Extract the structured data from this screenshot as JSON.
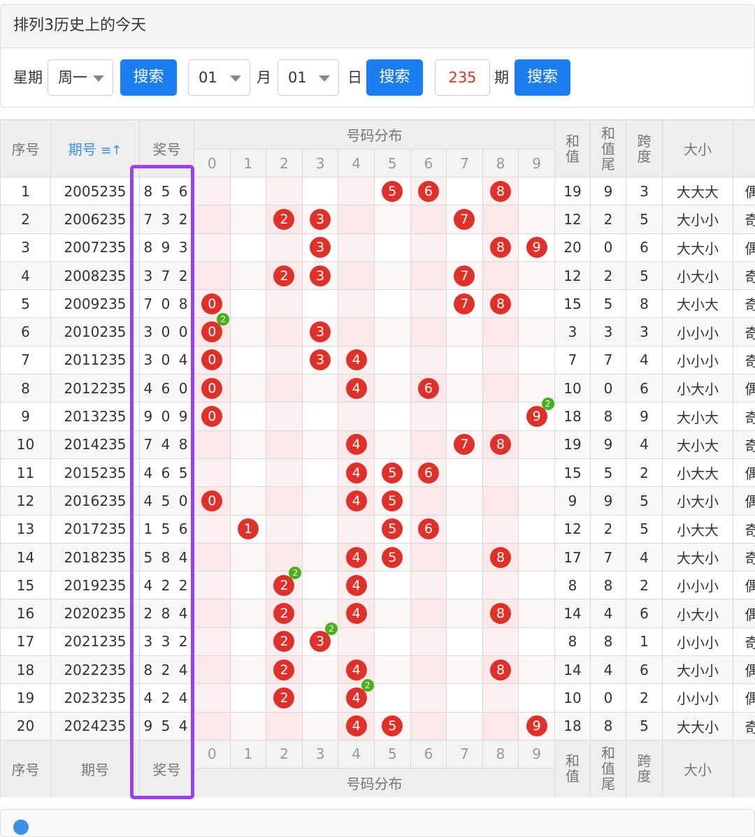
{
  "panel": {
    "title": "排列3历史上的今天",
    "weekday_label": "星期",
    "weekday_value": "周一",
    "search1": "搜索",
    "month_value": "01",
    "month_label": "月",
    "day_value": "01",
    "day_label": "日",
    "search2": "搜索",
    "issue_value": "235",
    "issue_label": "期",
    "search3": "搜索"
  },
  "table": {
    "headers": {
      "index": "序号",
      "issue": "期号",
      "sort_icon": "sort-icon",
      "prize": "奖号",
      "distribution": "号码分布",
      "sum": "和值",
      "sum_tail": "和值尾",
      "span": "跨度",
      "size": "大小"
    },
    "digits": [
      "0",
      "1",
      "2",
      "3",
      "4",
      "5",
      "6",
      "7",
      "8",
      "9"
    ],
    "rows": [
      {
        "idx": "1",
        "issue": "2005235",
        "prize": "8 5 6",
        "balls": [
          "5",
          "6",
          "8"
        ],
        "repeat": null,
        "sum": "19",
        "tail": "9",
        "span": "3",
        "size": "大大大",
        "parity": "偶"
      },
      {
        "idx": "2",
        "issue": "2006235",
        "prize": "7 3 2",
        "balls": [
          "2",
          "3",
          "7"
        ],
        "repeat": null,
        "sum": "12",
        "tail": "2",
        "span": "5",
        "size": "大小小",
        "parity": "奇"
      },
      {
        "idx": "3",
        "issue": "2007235",
        "prize": "8 9 3",
        "balls": [
          "3",
          "8",
          "9"
        ],
        "repeat": null,
        "sum": "20",
        "tail": "0",
        "span": "6",
        "size": "大大小",
        "parity": "偶"
      },
      {
        "idx": "4",
        "issue": "2008235",
        "prize": "3 7 2",
        "balls": [
          "2",
          "3",
          "7"
        ],
        "repeat": null,
        "sum": "12",
        "tail": "2",
        "span": "5",
        "size": "小大小",
        "parity": "奇"
      },
      {
        "idx": "5",
        "issue": "2009235",
        "prize": "7 0 8",
        "balls": [
          "0",
          "7",
          "8"
        ],
        "repeat": null,
        "sum": "15",
        "tail": "5",
        "span": "8",
        "size": "大小大",
        "parity": "奇"
      },
      {
        "idx": "6",
        "issue": "2010235",
        "prize": "3 0 0",
        "balls": [
          "0",
          "3"
        ],
        "repeat": {
          "digit": "0",
          "count": "2"
        },
        "sum": "3",
        "tail": "3",
        "span": "3",
        "size": "小小小",
        "parity": "奇"
      },
      {
        "idx": "7",
        "issue": "2011235",
        "prize": "3 0 4",
        "balls": [
          "0",
          "3",
          "4"
        ],
        "repeat": null,
        "sum": "7",
        "tail": "7",
        "span": "4",
        "size": "小小小",
        "parity": "奇"
      },
      {
        "idx": "8",
        "issue": "2012235",
        "prize": "4 6 0",
        "balls": [
          "0",
          "4",
          "6"
        ],
        "repeat": null,
        "sum": "10",
        "tail": "0",
        "span": "6",
        "size": "小大小",
        "parity": "偶"
      },
      {
        "idx": "9",
        "issue": "2013235",
        "prize": "9 0 9",
        "balls": [
          "0",
          "9"
        ],
        "repeat": {
          "digit": "9",
          "count": "2"
        },
        "sum": "18",
        "tail": "8",
        "span": "9",
        "size": "大小大",
        "parity": "奇"
      },
      {
        "idx": "10",
        "issue": "2014235",
        "prize": "7 4 8",
        "balls": [
          "4",
          "7",
          "8"
        ],
        "repeat": null,
        "sum": "19",
        "tail": "9",
        "span": "4",
        "size": "大小大",
        "parity": "奇"
      },
      {
        "idx": "11",
        "issue": "2015235",
        "prize": "4 6 5",
        "balls": [
          "4",
          "5",
          "6"
        ],
        "repeat": null,
        "sum": "15",
        "tail": "5",
        "span": "2",
        "size": "小大大",
        "parity": "偶"
      },
      {
        "idx": "12",
        "issue": "2016235",
        "prize": "4 5 0",
        "balls": [
          "0",
          "4",
          "5"
        ],
        "repeat": null,
        "sum": "9",
        "tail": "9",
        "span": "5",
        "size": "小大小",
        "parity": "偶"
      },
      {
        "idx": "13",
        "issue": "2017235",
        "prize": "1 5 6",
        "balls": [
          "1",
          "5",
          "6"
        ],
        "repeat": null,
        "sum": "12",
        "tail": "2",
        "span": "5",
        "size": "小大大",
        "parity": "奇"
      },
      {
        "idx": "14",
        "issue": "2018235",
        "prize": "5 8 4",
        "balls": [
          "4",
          "5",
          "8"
        ],
        "repeat": null,
        "sum": "17",
        "tail": "7",
        "span": "4",
        "size": "大大小",
        "parity": "奇"
      },
      {
        "idx": "15",
        "issue": "2019235",
        "prize": "4 2 2",
        "balls": [
          "2",
          "4"
        ],
        "repeat": {
          "digit": "2",
          "count": "2"
        },
        "sum": "8",
        "tail": "8",
        "span": "2",
        "size": "小小小",
        "parity": "偶"
      },
      {
        "idx": "16",
        "issue": "2020235",
        "prize": "2 8 4",
        "balls": [
          "2",
          "4",
          "8"
        ],
        "repeat": null,
        "sum": "14",
        "tail": "4",
        "span": "6",
        "size": "小大小",
        "parity": "偶"
      },
      {
        "idx": "17",
        "issue": "2021235",
        "prize": "3 3 2",
        "balls": [
          "2",
          "3"
        ],
        "repeat": {
          "digit": "3",
          "count": "2"
        },
        "sum": "8",
        "tail": "8",
        "span": "1",
        "size": "小小小",
        "parity": "奇"
      },
      {
        "idx": "18",
        "issue": "2022235",
        "prize": "8 2 4",
        "balls": [
          "2",
          "4",
          "8"
        ],
        "repeat": null,
        "sum": "14",
        "tail": "4",
        "span": "6",
        "size": "大小小",
        "parity": "偶"
      },
      {
        "idx": "19",
        "issue": "2023235",
        "prize": "4 2 4",
        "balls": [
          "2",
          "4"
        ],
        "repeat": {
          "digit": "4",
          "count": "2"
        },
        "sum": "10",
        "tail": "0",
        "span": "2",
        "size": "小小小",
        "parity": "偶"
      },
      {
        "idx": "20",
        "issue": "2024235",
        "prize": "9 5 4",
        "balls": [
          "4",
          "5",
          "9"
        ],
        "repeat": null,
        "sum": "18",
        "tail": "8",
        "span": "5",
        "size": "大大小",
        "parity": "奇"
      }
    ]
  },
  "colors": {
    "ball": "#e0302a",
    "repeat_badge": "#4caf1e",
    "button": "#1a7ef0",
    "highlight": "#9b3ff2",
    "prize_text": "#e0302a",
    "sort_header": "#3f8fe8"
  }
}
